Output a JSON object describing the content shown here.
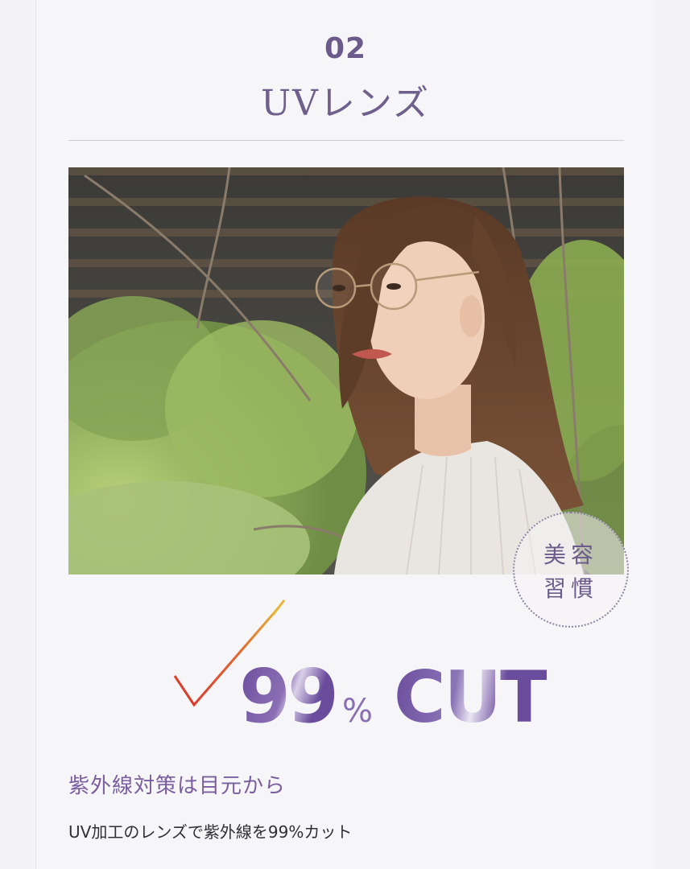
{
  "section": {
    "number": "02",
    "title": "UVレンズ"
  },
  "photo": {
    "description_icon": "portrait-photo"
  },
  "badge": {
    "line1": "美容",
    "line2": "習慣"
  },
  "stat": {
    "value": "99",
    "unit": "%",
    "word": "CUT"
  },
  "headline": "紫外線対策は目元から",
  "body": "UV加工のレンズで紫外線を99%カット",
  "colors": {
    "accent": "#7556a0",
    "check_red": "#d9342b",
    "check_gold": "#e7b53a"
  }
}
